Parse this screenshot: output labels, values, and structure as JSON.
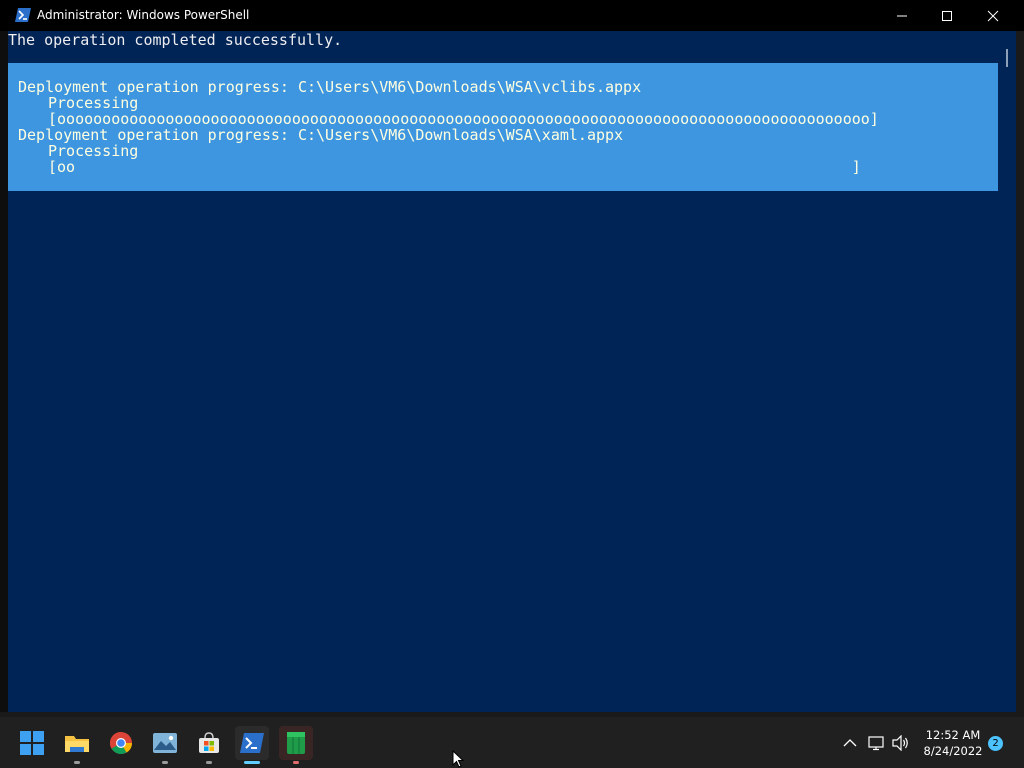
{
  "window": {
    "title": "Administrator: Windows PowerShell"
  },
  "console": {
    "lines": [
      "The operation completed successfully."
    ],
    "progress": [
      {
        "header": "Deployment operation progress: C:\\Users\\VM6\\Downloads\\WSA\\vclibs.appx",
        "status": "Processing",
        "bar": "[oooooooooooooooooooooooooooooooooooooooooooooooooooooooooooooooooooooooooooooooooooooooooo]"
      },
      {
        "header": "Deployment operation progress: C:\\Users\\VM6\\Downloads\\WSA\\xaml.appx",
        "status": "Processing",
        "bar": "[oo                                                                                      ]"
      }
    ]
  },
  "taskbar": {
    "apps": [
      {
        "name": "start-icon"
      },
      {
        "name": "file-explorer-icon"
      },
      {
        "name": "chrome-icon"
      },
      {
        "name": "photos-icon"
      },
      {
        "name": "store-icon"
      },
      {
        "name": "powershell-icon"
      },
      {
        "name": "green-app-icon"
      }
    ],
    "time": "12:52 AM",
    "date": "8/24/2022",
    "notification_count": "2"
  },
  "colors": {
    "console_bg": "#012456",
    "progress_bg": "#3e96e0",
    "accent": "#60cdff"
  }
}
